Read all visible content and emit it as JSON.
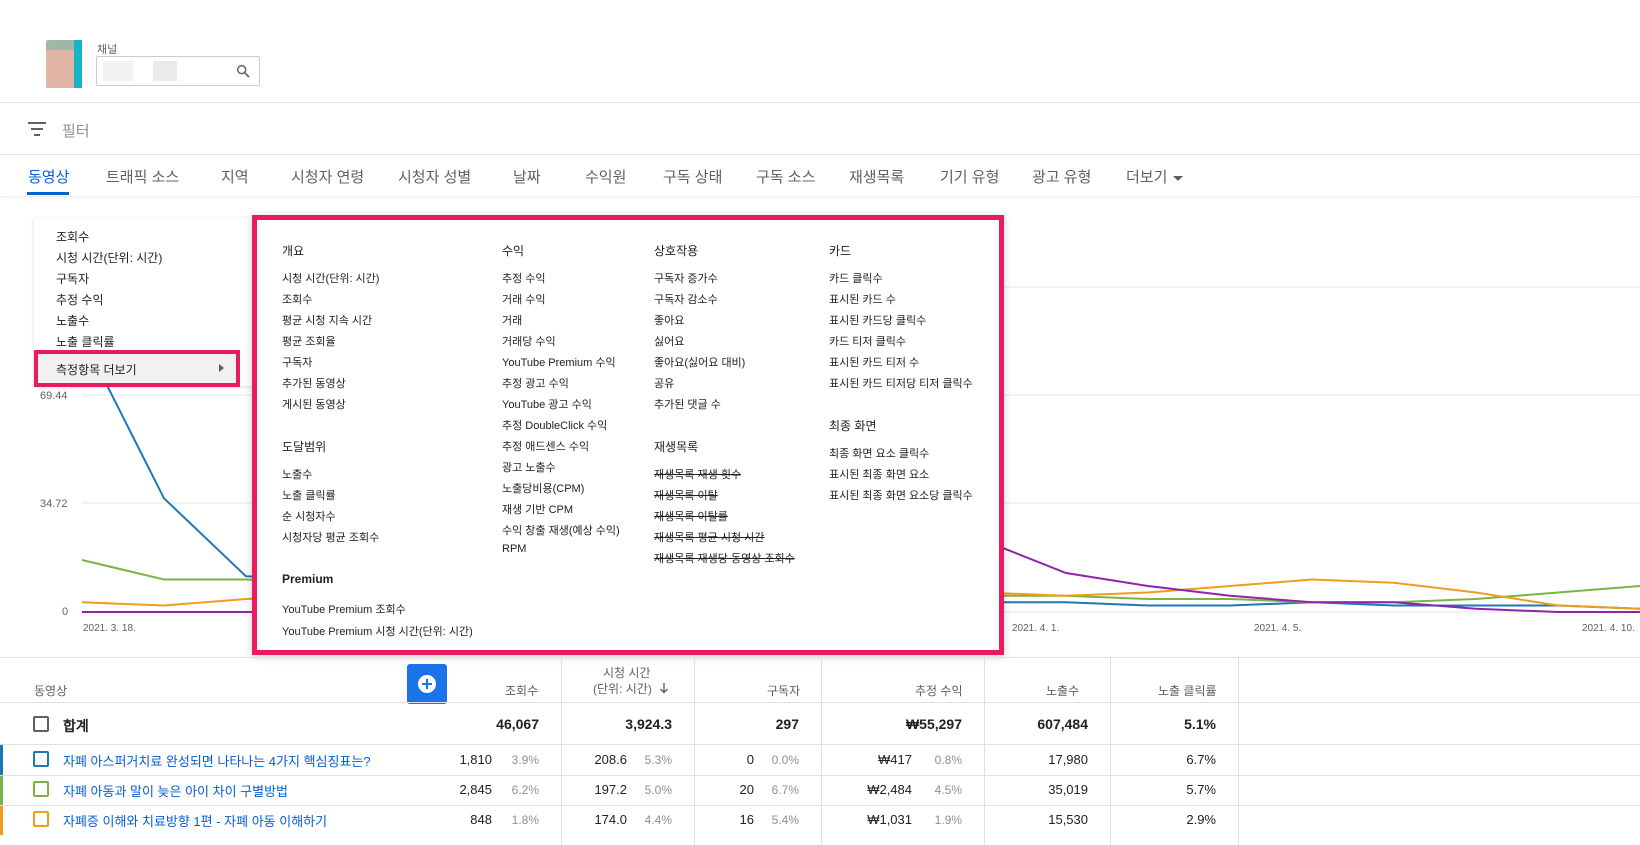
{
  "header": {
    "channel_label": "채널",
    "search_icon": "search-icon"
  },
  "filter": {
    "label": "필터",
    "icon": "filter-icon"
  },
  "tabs": [
    {
      "label": "동영상",
      "active": true
    },
    {
      "label": "트래픽 소스"
    },
    {
      "label": "지역"
    },
    {
      "label": "시청자 연령"
    },
    {
      "label": "시청자 성별"
    },
    {
      "label": "날짜"
    },
    {
      "label": "수익원"
    },
    {
      "label": "구독 상태"
    },
    {
      "label": "구독 소스"
    },
    {
      "label": "재생목록"
    },
    {
      "label": "기기 유형"
    },
    {
      "label": "광고 유형"
    },
    {
      "label": "더보기"
    }
  ],
  "metric_menu": {
    "items": [
      "조회수",
      "시청 시간(단위: 시간)",
      "구독자",
      "추정 수익",
      "노출수",
      "노출 클릭률"
    ],
    "more_label": "측정항목 더보기"
  },
  "metrics_panel": {
    "overview": {
      "title": "개요",
      "items": [
        "시청 시간(단위: 시간)",
        "조회수",
        "평균 시청 지속 시간",
        "평균 조회율",
        "구독자",
        "추가된 동영상",
        "게시된 동영상"
      ]
    },
    "reach": {
      "title": "도달범위",
      "items": [
        "노출수",
        "노출 클릭률",
        "순 시청자수",
        "시청자당 평균 조회수"
      ]
    },
    "premium": {
      "title": "Premium",
      "items": [
        "YouTube Premium 조회수",
        "YouTube Premium 시청 시간(단위: 시간)"
      ]
    },
    "revenue": {
      "title": "수익",
      "items": [
        "추정 수익",
        "거래 수익",
        "거래",
        "거래당 수익",
        "YouTube Premium 수익",
        "추정 광고 수익",
        "YouTube 광고 수익",
        "추정 DoubleClick 수익",
        "추정 애드센스 수익",
        "광고 노출수",
        "노출당비용(CPM)",
        "재생 기반 CPM",
        "수익 창출 재생(예상 수익)",
        "RPM"
      ]
    },
    "interaction": {
      "title": "상호작용",
      "items": [
        "구독자 증가수",
        "구독자 감소수",
        "좋아요",
        "싫어요",
        "좋아요(싫어요 대비)",
        "공유",
        "추가된 댓글 수"
      ]
    },
    "playlist": {
      "title": "재생목록",
      "items": [
        "재생목록 재생 횟수",
        "재생목록 이탈",
        "재생목록 이탈률",
        "재생목록 평균 시청 시간",
        "재생목록 재생당 동영상 조회수"
      ]
    },
    "cards": {
      "title": "카드",
      "items": [
        "카드 클릭수",
        "표시된 카드 수",
        "표시된 카드당 클릭수",
        "카드 티저 클릭수",
        "표시된 카드 티저 수",
        "표시된 카드 티저당 티저 클릭수"
      ]
    },
    "end_screen": {
      "title": "최종 화면",
      "items": [
        "최종 화면 요소 클릭수",
        "표시된 최종 화면 요소",
        "표시된 최종 화면 요소당 클릭수"
      ]
    }
  },
  "chart_data": {
    "type": "line",
    "x_tick_labels": [
      "2021. 3. 18.",
      "2021. 4. 1.",
      "2021. 4. 5.",
      "2021. 4. 10."
    ],
    "y_tick_labels": [
      "69.44",
      "34.72",
      "0"
    ],
    "grid": true,
    "series": [
      {
        "color": "#1f77b4",
        "values": [
          85,
          35,
          11,
          10,
          9,
          8,
          7,
          6,
          6,
          5,
          4,
          3,
          3,
          2,
          2,
          3,
          2,
          2,
          2,
          1
        ]
      },
      {
        "color": "#7cb342",
        "values": [
          16,
          10,
          10,
          9,
          9,
          8,
          8,
          7,
          7,
          6,
          6,
          5,
          5,
          4,
          4,
          3,
          3,
          4,
          6,
          8
        ]
      },
      {
        "color": "#f29b1d",
        "values": [
          3,
          2,
          4,
          5,
          6,
          7,
          7,
          6,
          7,
          8,
          7,
          6,
          5,
          6,
          8,
          10,
          9,
          6,
          2,
          1
        ]
      },
      {
        "color": "#8e24aa",
        "values": [
          0,
          0,
          0,
          0,
          0,
          1,
          1,
          1,
          2,
          3,
          100,
          22,
          12,
          8,
          5,
          3,
          3,
          1,
          0,
          0
        ]
      }
    ],
    "ylim": [
      0,
      100
    ]
  },
  "table": {
    "headers": {
      "video": "동영상",
      "views": "조회수",
      "watch_time_1": "시청 시간",
      "watch_time_2": "(단위: 시간)",
      "subscribers": "구독자",
      "revenue": "추정 수익",
      "impressions": "노출수",
      "ctr": "노출 클릭률"
    },
    "total": {
      "label": "합계",
      "views": "46,067",
      "watch_time": "3,924.3",
      "subscribers": "297",
      "revenue": "₩55,297",
      "impressions": "607,484",
      "ctr": "5.1%"
    },
    "rows": [
      {
        "color": "#1f77b4",
        "title": "자폐 아스퍼거치료 완성되면 나타나는 4가지 핵심징표는?",
        "views": "1,810",
        "views_pct": "3.9%",
        "watch": "208.6",
        "watch_pct": "5.3%",
        "subs": "0",
        "subs_pct": "0.0%",
        "revenue": "₩417",
        "revenue_pct": "0.8%",
        "impressions": "17,980",
        "ctr": "6.7%"
      },
      {
        "color": "#7cb342",
        "title": "자폐 아동과 말이 늦은 아이 차이 구별방법",
        "views": "2,845",
        "views_pct": "6.2%",
        "watch": "197.2",
        "watch_pct": "5.0%",
        "subs": "20",
        "subs_pct": "6.7%",
        "revenue": "₩2,484",
        "revenue_pct": "4.5%",
        "impressions": "35,019",
        "ctr": "5.7%"
      },
      {
        "color": "#f29b1d",
        "title": "자폐증 이해와 치료방향 1편 - 자폐 아동 이해하기",
        "views": "848",
        "views_pct": "1.8%",
        "watch": "174.0",
        "watch_pct": "4.4%",
        "subs": "16",
        "subs_pct": "5.4%",
        "revenue": "₩1,031",
        "revenue_pct": "1.9%",
        "impressions": "15,530",
        "ctr": "2.9%"
      }
    ]
  }
}
